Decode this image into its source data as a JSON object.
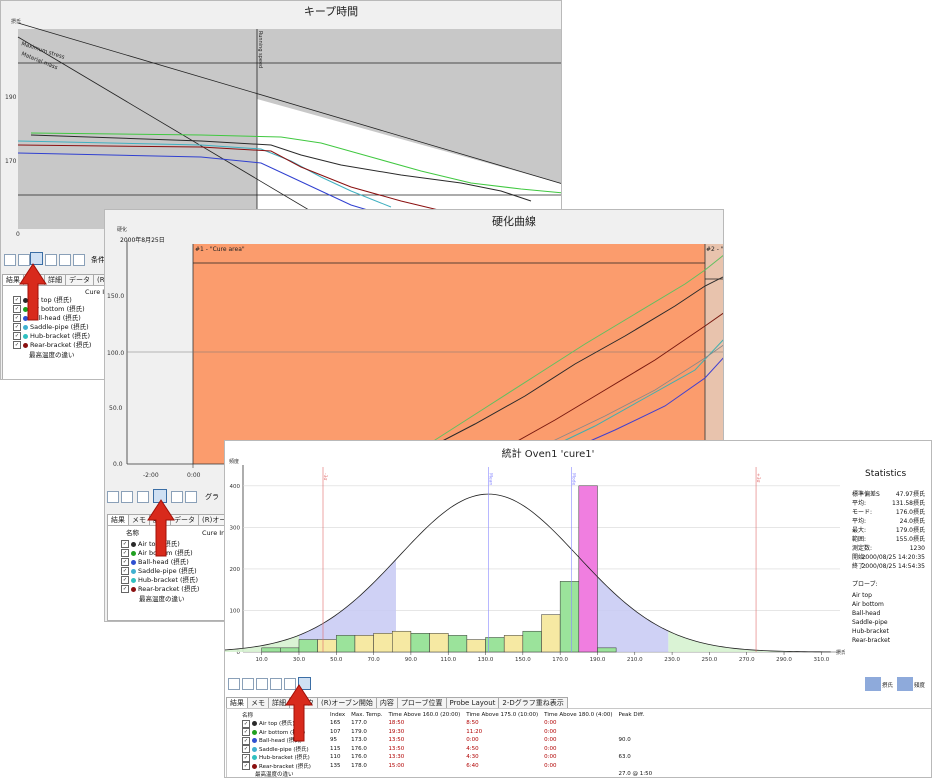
{
  "win1": {
    "title": "キープ時間",
    "yaxis_unit": "摂氏",
    "y_ticks": [
      "190",
      "170"
    ],
    "x_tick": "0",
    "diag_labels": [
      "Maximum stress",
      "Material mass"
    ],
    "vline_label": "Running speed",
    "toolbar_extra": "条件",
    "tabs": [
      "結果",
      "メモ",
      "詳細",
      "データ",
      "(R)オー"
    ],
    "col_header": "Cure In",
    "probes": [
      "Air top (摂氏)",
      "Air bottom (摂氏)",
      "Ball-head (摂氏)",
      "Saddle-pipe (摂氏)",
      "Hub-bracket (摂氏)",
      "Rear-bracket (摂氏)"
    ],
    "footer": "最高温度の違い"
  },
  "win2": {
    "title": "硬化曲線",
    "yaxis_unit": "硬化",
    "date_label": "2000年8月25日",
    "y_ticks": [
      "150.0",
      "100.0",
      "50.0",
      "0.0"
    ],
    "x_ticks": [
      "-2:00",
      "0:00"
    ],
    "region1": "#1 - \"Cure area\"",
    "region2": "#2 - \"",
    "toolbar_extra": "グラ",
    "tabs": [
      "結果",
      "メモ",
      "詳細",
      "データ",
      "(R)オープ"
    ],
    "col_name": "名称",
    "col_cure": "Cure Inc",
    "probes": [
      "Air top (摂氏)",
      "Air bottom (摂氏)",
      "Ball-head (摂氏)",
      "Saddle-pipe (摂氏)",
      "Hub-bracket (摂氏)",
      "Rear-bracket (摂氏)"
    ],
    "footer": "最高温度の違い"
  },
  "win3": {
    "title": "統計 Oven1 'cure1'",
    "yaxis_unit": "頻度",
    "y_ticks": [
      "400",
      "300",
      "200",
      "100",
      "0"
    ],
    "x_ticks": [
      "10.0",
      "30.0",
      "50.0",
      "70.0",
      "90.0",
      "110.0",
      "130.0",
      "150.0",
      "170.0",
      "190.0",
      "210.0",
      "230.0",
      "250.0",
      "270.0",
      "290.0",
      "310.0"
    ],
    "x_unit": "摂氏",
    "marker_labels": [
      "-3σ",
      "Mean",
      "Mode",
      "+3σ"
    ],
    "statistics_title": "Statistics",
    "stats": [
      {
        "k": "標準偏差S",
        "v": "47.97摂氏"
      },
      {
        "k": "平均:",
        "v": "131.58摂氏"
      },
      {
        "k": "モード:",
        "v": "176.0摂氏"
      },
      {
        "k": "平均:",
        "v": "24.0摂氏"
      },
      {
        "k": "最大:",
        "v": "179.0摂氏"
      },
      {
        "k": "範囲:",
        "v": "155.0摂氏"
      },
      {
        "k": "測定数:",
        "v": "1230"
      },
      {
        "k": "開始:",
        "v": "2000/08/25 14:20:35"
      },
      {
        "k": "終了:",
        "v": "2000/08/25 14:54:35"
      }
    ],
    "probes_title": "プローブ:",
    "probe_list": [
      "Air top",
      "Air bottom",
      "Ball-head",
      "Saddle-pipe",
      "Hub-bracket",
      "Rear-bracket"
    ],
    "legend_right": [
      "摂氏",
      "頻度"
    ],
    "tabs": [
      "結果",
      "メモ",
      "詳細",
      "データ",
      "(R)オーブン開始",
      "内容",
      "プローブ位置",
      "Probe Layout",
      "2-Dグラフ重ね表示"
    ],
    "table_headers": [
      "名称",
      "Index",
      "Max. Temp.",
      "Time Above 160.0 (20:00)",
      "Time Above 175.0 (10:00)",
      "Time Above 180.0 (4:00)",
      "Peak Diff."
    ],
    "table_rows": [
      {
        "name": "Air top (摂氏)",
        "index": "165",
        "max": "177.0",
        "t160": "18:50",
        "t175": "8:50",
        "t180": "0:00",
        "peak": ""
      },
      {
        "name": "Air bottom (摂氏)",
        "index": "107",
        "max": "179.0",
        "t160": "19:30",
        "t175": "11:20",
        "t180": "0:00",
        "peak": ""
      },
      {
        "name": "Ball-head (摂氏)",
        "index": "95",
        "max": "173.0",
        "t160": "13:50",
        "t175": "0:00",
        "t180": "0:00",
        "peak": "90.0"
      },
      {
        "name": "Saddle-pipe (摂氏)",
        "index": "115",
        "max": "176.0",
        "t160": "13:50",
        "t175": "4:50",
        "t180": "0:00",
        "peak": ""
      },
      {
        "name": "Hub-bracket (摂氏)",
        "index": "110",
        "max": "176.0",
        "t160": "13:30",
        "t175": "4:30",
        "t180": "0:00",
        "peak": "63.0"
      },
      {
        "name": "Rear-bracket (摂氏)",
        "index": "135",
        "max": "178.0",
        "t160": "15:00",
        "t175": "6:40",
        "t180": "0:00",
        "peak": ""
      }
    ],
    "table_footer_label": "最高温度の違い",
    "table_footer_value": "27.0 @ 1:50"
  },
  "probe_colors": [
    "#2a2a2a",
    "#20a020",
    "#3050d0",
    "#40b0d0",
    "#30c0c0",
    "#8a1010"
  ],
  "chart_data": [
    {
      "type": "line",
      "title": "キープ時間",
      "ylabel": "摂氏",
      "y_ticks": [
        190,
        170
      ]
    },
    {
      "type": "line",
      "title": "硬化曲線",
      "ylabel": "硬化",
      "ylim": [
        0,
        175
      ],
      "y_ticks": [
        0,
        50,
        100,
        150
      ],
      "x_ticks": [
        "-2:00",
        "0:00"
      ],
      "regions": [
        "#1 - \"Cure area\"",
        "#2 - \""
      ]
    },
    {
      "type": "bar",
      "title": "統計 Oven1 'cure1'",
      "ylabel": "頻度",
      "xlabel": "摂氏",
      "ylim": [
        0,
        450
      ],
      "xlim": [
        0,
        320
      ],
      "bin_width": 10,
      "bins": [
        {
          "x": 10,
          "value": 10,
          "color": "#9be39b"
        },
        {
          "x": 20,
          "value": 10,
          "color": "#9be39b"
        },
        {
          "x": 30,
          "value": 30,
          "color": "#9be39b"
        },
        {
          "x": 40,
          "value": 30,
          "color": "#f6e9a3"
        },
        {
          "x": 50,
          "value": 40,
          "color": "#9be39b"
        },
        {
          "x": 60,
          "value": 40,
          "color": "#f6e9a3"
        },
        {
          "x": 70,
          "value": 45,
          "color": "#f6e9a3"
        },
        {
          "x": 80,
          "value": 50,
          "color": "#f6e9a3"
        },
        {
          "x": 90,
          "value": 45,
          "color": "#9be39b"
        },
        {
          "x": 100,
          "value": 45,
          "color": "#f6e9a3"
        },
        {
          "x": 110,
          "value": 40,
          "color": "#9be39b"
        },
        {
          "x": 120,
          "value": 30,
          "color": "#f6e9a3"
        },
        {
          "x": 130,
          "value": 35,
          "color": "#9be39b"
        },
        {
          "x": 140,
          "value": 40,
          "color": "#f6e9a3"
        },
        {
          "x": 150,
          "value": 50,
          "color": "#9be39b"
        },
        {
          "x": 160,
          "value": 90,
          "color": "#f6e9a3"
        },
        {
          "x": 170,
          "value": 170,
          "color": "#9be39b"
        },
        {
          "x": 180,
          "value": 400,
          "color": "#f07ee0"
        },
        {
          "x": 190,
          "value": 10,
          "color": "#9be39b"
        }
      ],
      "normal_curve": {
        "mean": 131.58,
        "sd": 47.97,
        "peak": 380
      },
      "markers": [
        {
          "label": "-3σ",
          "x": -12
        },
        {
          "label": "Mean",
          "x": 131.58
        },
        {
          "label": "Mode",
          "x": 176
        },
        {
          "label": "+3σ",
          "x": 275
        }
      ]
    }
  ]
}
